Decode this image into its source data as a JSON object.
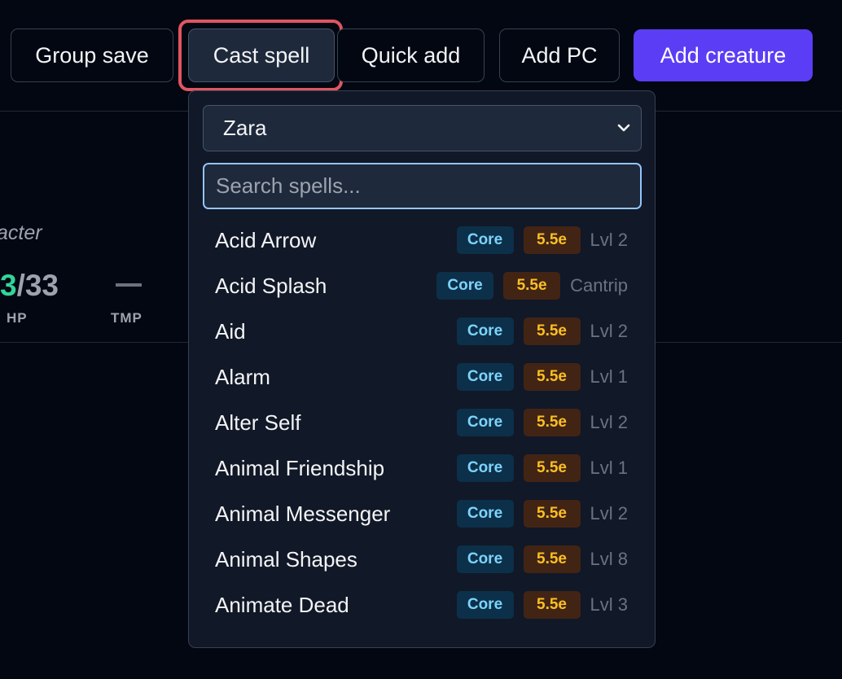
{
  "toolbar": {
    "group_save": "Group save",
    "cast_spell": "Cast spell",
    "quick_add": "Quick add",
    "add_pc": "Add PC",
    "add_creature": "Add creature",
    "accent_color": "#5b3df5",
    "focus_color": "#e05561"
  },
  "background": {
    "character_subtitle": "acter",
    "hp_current": "3",
    "hp_max": "/33",
    "hp_label": "HP",
    "tmp_label": "TMP"
  },
  "spell_panel": {
    "caster": "Zara",
    "search_placeholder": "Search spells...",
    "spells": [
      {
        "name": "Acid Arrow",
        "source": "Core",
        "edition": "5.5e",
        "level": "Lvl 2"
      },
      {
        "name": "Acid Splash",
        "source": "Core",
        "edition": "5.5e",
        "level": "Cantrip"
      },
      {
        "name": "Aid",
        "source": "Core",
        "edition": "5.5e",
        "level": "Lvl 2"
      },
      {
        "name": "Alarm",
        "source": "Core",
        "edition": "5.5e",
        "level": "Lvl 1"
      },
      {
        "name": "Alter Self",
        "source": "Core",
        "edition": "5.5e",
        "level": "Lvl 2"
      },
      {
        "name": "Animal Friendship",
        "source": "Core",
        "edition": "5.5e",
        "level": "Lvl 1"
      },
      {
        "name": "Animal Messenger",
        "source": "Core",
        "edition": "5.5e",
        "level": "Lvl 2"
      },
      {
        "name": "Animal Shapes",
        "source": "Core",
        "edition": "5.5e",
        "level": "Lvl 8"
      },
      {
        "name": "Animate Dead",
        "source": "Core",
        "edition": "5.5e",
        "level": "Lvl 3"
      }
    ]
  }
}
